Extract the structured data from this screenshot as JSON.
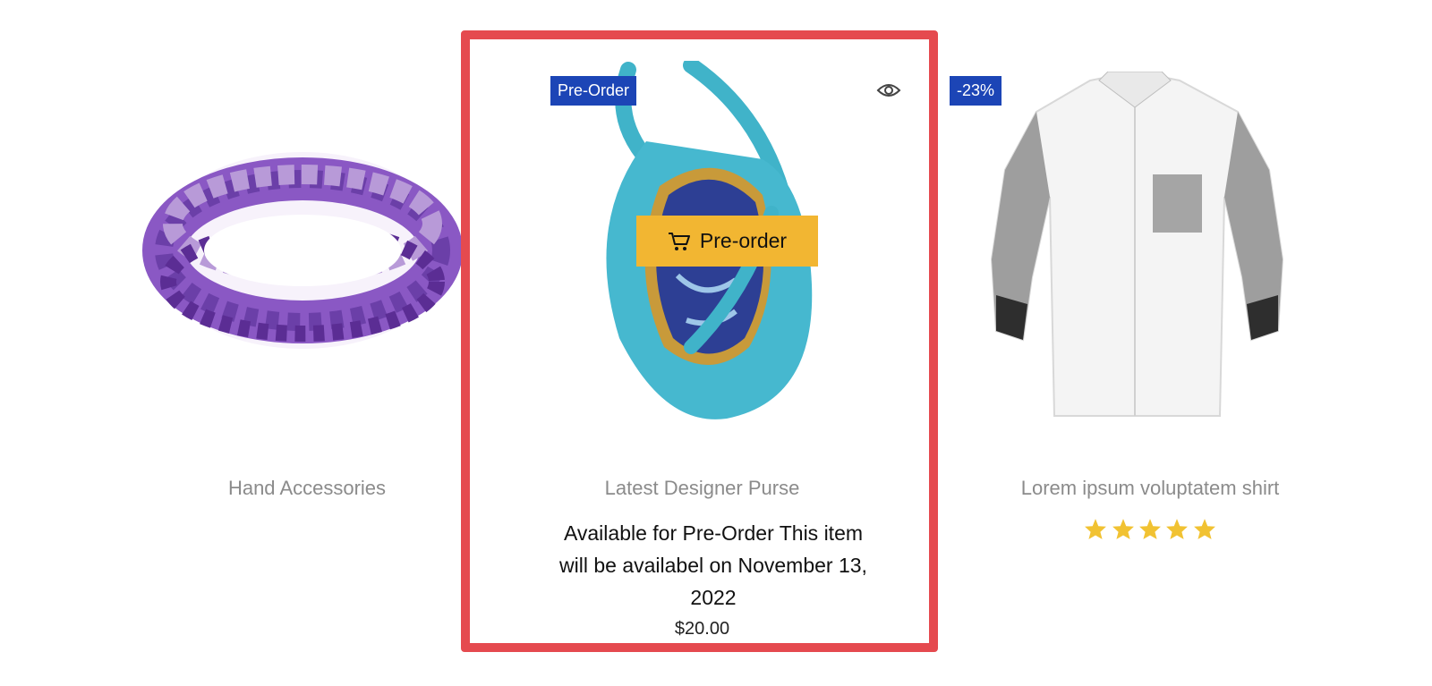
{
  "products": [
    {
      "title": "Hand Accessories"
    },
    {
      "badge": "Pre-Order",
      "cta_label": "Pre-order",
      "title": "Latest Designer Purse",
      "availability": "Available for Pre-Order This item will be availabel on November 13, 2022",
      "price": "$20.00"
    },
    {
      "badge": "-23%",
      "title": "Lorem ipsum voluptatem shirt",
      "rating": 5,
      "rating_max": 5
    }
  ],
  "colors": {
    "badge": "#1c45b6",
    "cta": "#f2b632",
    "highlight": "#e54a4f",
    "star": "#f1c232"
  },
  "icons": [
    "cart-icon",
    "eye-icon",
    "star-icon"
  ]
}
